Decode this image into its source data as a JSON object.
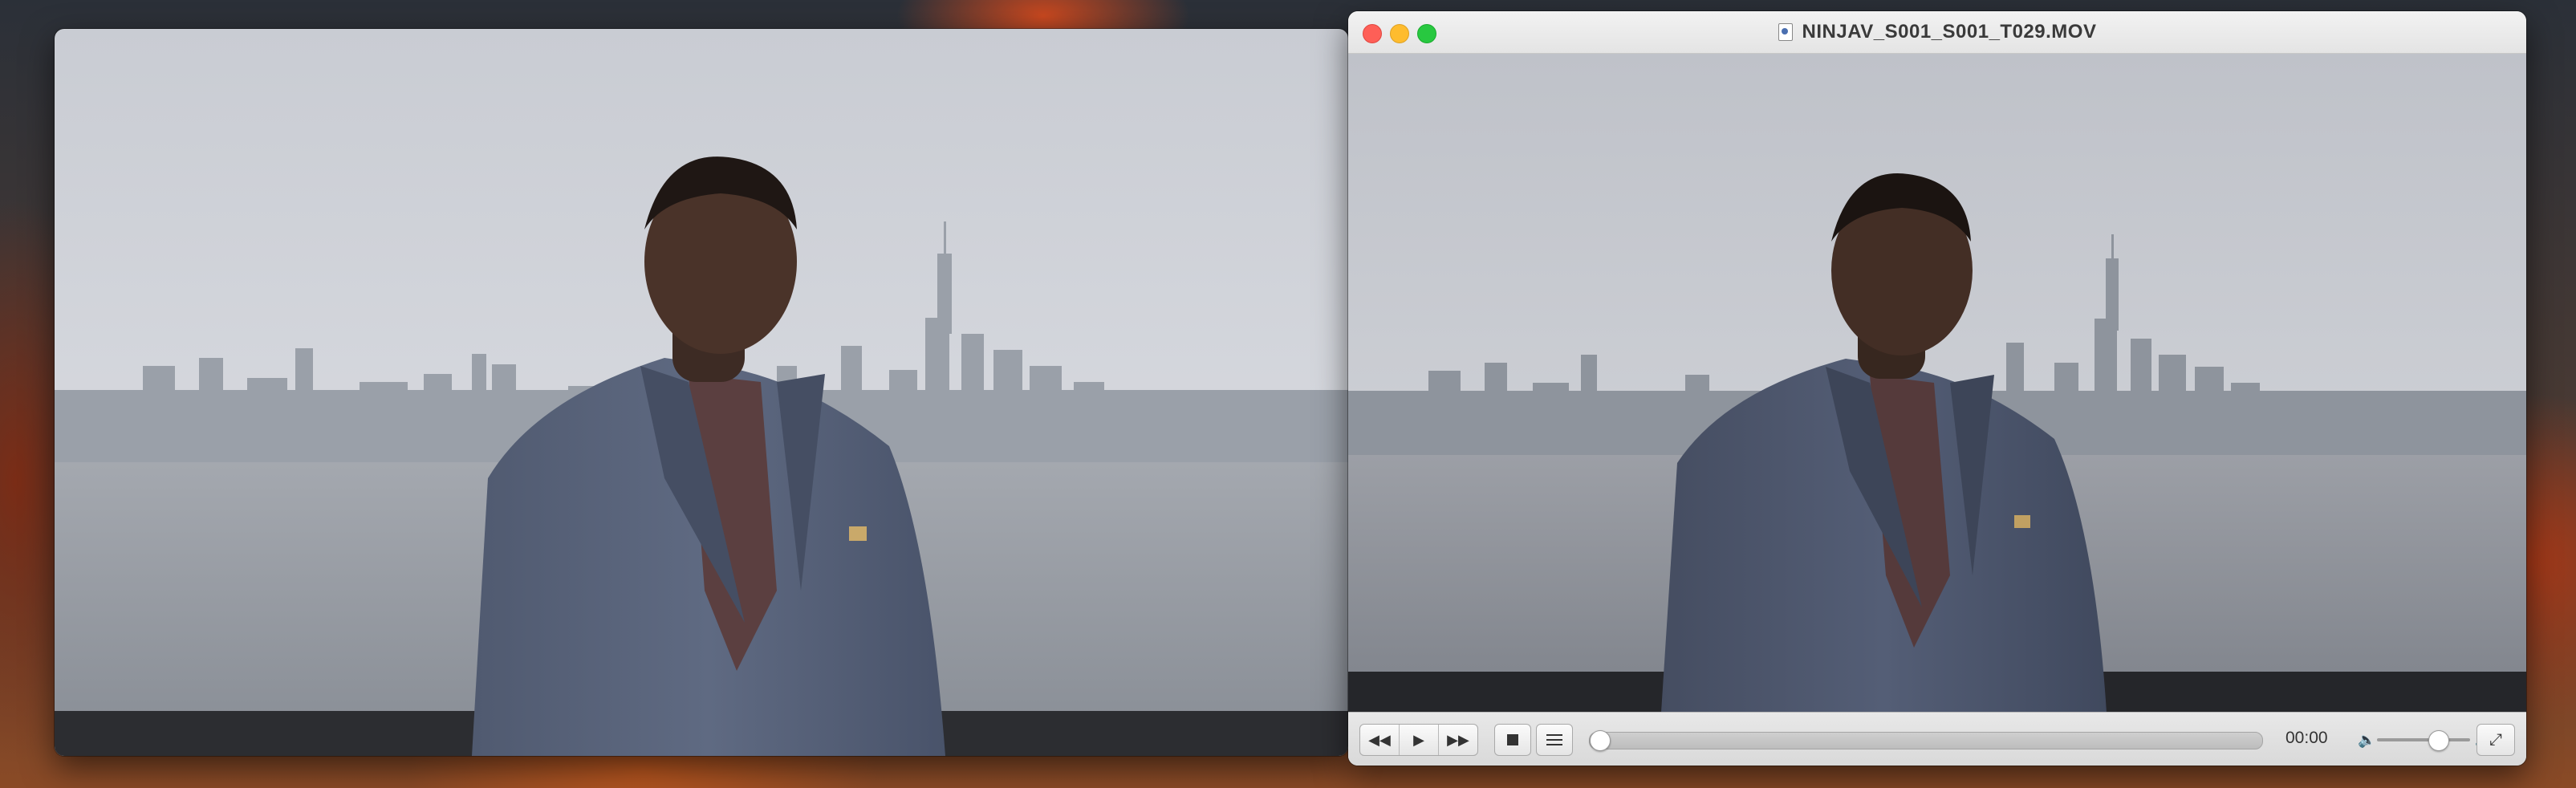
{
  "desktop": {
    "accent_colors": [
      "#2b3038",
      "#8a4a26",
      "#c9481f"
    ]
  },
  "vlc": {
    "window_title": "NINJAV_S001_S001_T029.MOV",
    "titlebar_icon": "document-icon",
    "controls": {
      "rewind_icon": "rewind-icon",
      "play_icon": "play-icon",
      "forward_icon": "fast-forward-icon",
      "stop_icon": "stop-icon",
      "playlist_icon": "playlist-icon",
      "elapsed_time": "00:00",
      "playback_progress": 0,
      "volume_level": 0.7,
      "volume_low_icon": "volume-low-icon",
      "volume_high_icon": "volume-high-icon",
      "fullscreen_icon": "fullscreen-icon"
    }
  },
  "icons": {
    "rewind": "◀◀",
    "play": "▶",
    "forward": "▶▶",
    "vol_low": "🔈",
    "vol_high": "🔊",
    "fullscreen": "⤢"
  }
}
